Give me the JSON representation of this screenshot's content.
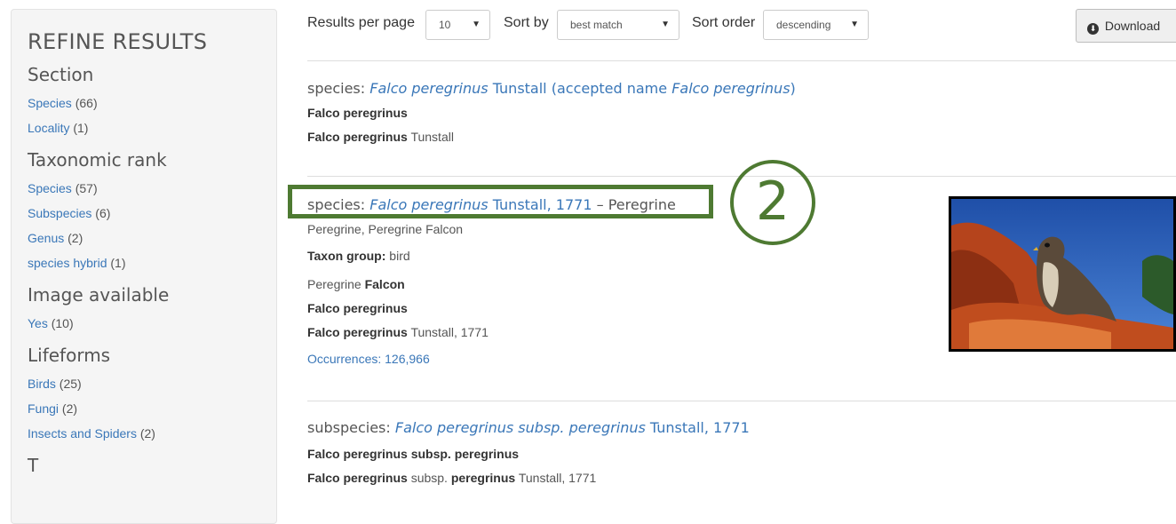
{
  "sidebar": {
    "title": "REFINE RESULTS",
    "groups": [
      {
        "title": "Section",
        "items": [
          {
            "label": "Species",
            "count": "(66)"
          },
          {
            "label": "Locality",
            "count": "(1)"
          }
        ]
      },
      {
        "title": "Taxonomic rank",
        "items": [
          {
            "label": "Species",
            "count": "(57)"
          },
          {
            "label": "Subspecies",
            "count": "(6)"
          },
          {
            "label": "Genus",
            "count": "(2)"
          },
          {
            "label": "species hybrid",
            "count": "(1)"
          }
        ]
      },
      {
        "title": "Image available",
        "items": [
          {
            "label": "Yes",
            "count": "(10)"
          }
        ]
      },
      {
        "title": "Lifeforms",
        "items": [
          {
            "label": "Birds",
            "count": "(25)"
          },
          {
            "label": "Fungi",
            "count": "(2)"
          },
          {
            "label": "Insects and Spiders",
            "count": "(2)"
          }
        ]
      }
    ],
    "partial_title": "T"
  },
  "toolbar": {
    "results_per_page_label": "Results per page",
    "results_per_page_value": "10",
    "sort_by_label": "Sort by",
    "sort_by_value": "best match",
    "sort_order_label": "Sort order",
    "sort_order_value": "descending",
    "download_label": "Download",
    "caret": "▼",
    "download_icon": "⬇"
  },
  "results": [
    {
      "rank": "species:",
      "name": "Falco peregrinus",
      "author": "Tunstall",
      "accepted_prefix": "(accepted name",
      "accepted_name": "Falco peregrinus",
      "accepted_suffix": ")",
      "line1": "Falco peregrinus",
      "line2_bold": "Falco peregrinus",
      "line2_rest": "Tunstall"
    },
    {
      "rank": "species:",
      "name": "Falco peregrinus",
      "author": "Tunstall, 1771",
      "common": "– Peregrine",
      "common_names": "Peregrine, Peregrine Falcon",
      "taxon_group_label": "Taxon group:",
      "taxon_group_value": "bird",
      "line3_plain": "Peregrine",
      "line3_bold": "Falcon",
      "line4": "Falco peregrinus",
      "line5_bold": "Falco peregrinus",
      "line5_rest": "Tunstall, 1771",
      "occurrences": "Occurrences: 126,966"
    },
    {
      "rank": "subspecies:",
      "name": "Falco peregrinus subsp. peregrinus",
      "author": "Tunstall, 1771",
      "line1": "Falco peregrinus subsp. peregrinus",
      "line2_b1": "Falco peregrinus",
      "line2_m": "subsp.",
      "line2_b2": "peregrinus",
      "line2_rest": "Tunstall, 1771"
    }
  ],
  "annotation": {
    "number": "2"
  },
  "colors": {
    "link": "#3a77b8",
    "annotation": "#4e7a32",
    "sidebar_bg": "#f5f5f5"
  }
}
